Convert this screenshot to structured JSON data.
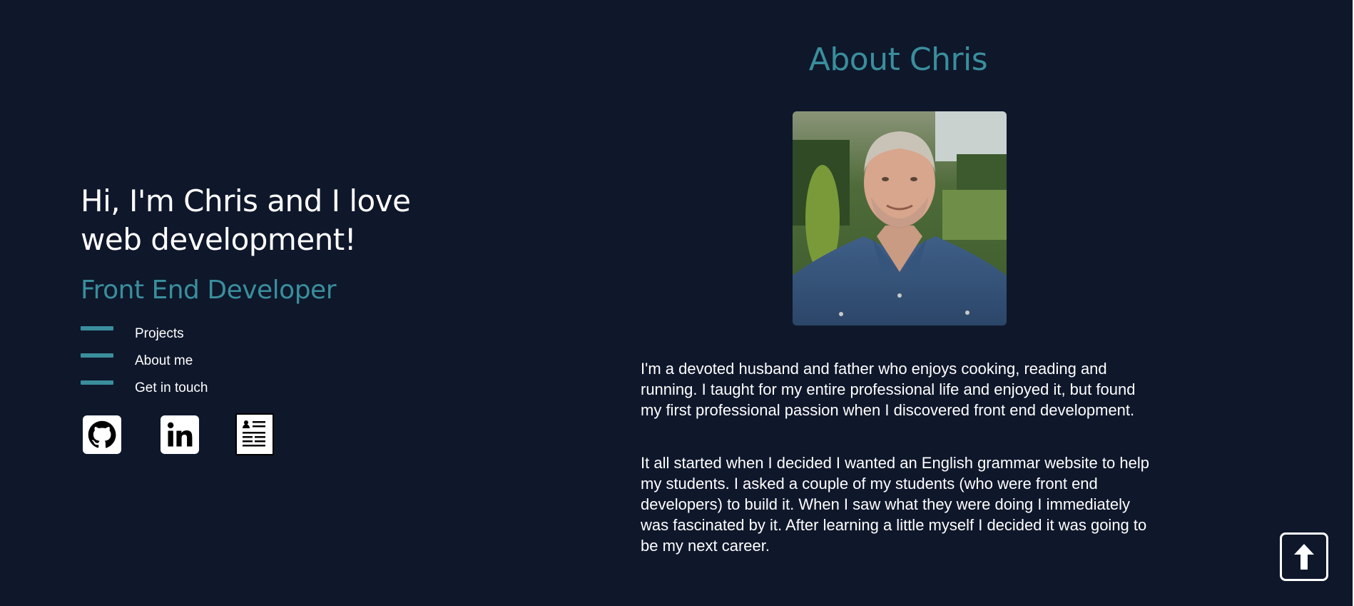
{
  "intro": {
    "headline": "Hi, I'm Chris and I love web development!",
    "role": "Front End Developer"
  },
  "nav": {
    "items": [
      {
        "label": "Projects"
      },
      {
        "label": "About me"
      },
      {
        "label": "Get in touch"
      }
    ]
  },
  "socials": [
    {
      "icon": "github-icon"
    },
    {
      "icon": "linkedin-icon"
    },
    {
      "icon": "resume-icon"
    }
  ],
  "about": {
    "title": "About Chris",
    "photo_alt": "portrait-photo",
    "paragraphs": [
      "I'm a devoted husband and father who enjoys cooking, reading and running. I taught for my entire professional life and enjoyed it, but found my first professional passion when I discovered front end development.",
      "It all started when I decided I wanted an English grammar website to help my students. I asked a couple of my students (who were front end developers) to build it. When I saw what they were doing I immediately was fascinated by it. After learning a little myself I decided it was going to be my next career."
    ]
  },
  "back_to_top": {
    "icon": "arrow-up-icon"
  },
  "colors": {
    "background": "#0f172b",
    "accent": "#3a8e9c",
    "text": "#ffffff"
  }
}
